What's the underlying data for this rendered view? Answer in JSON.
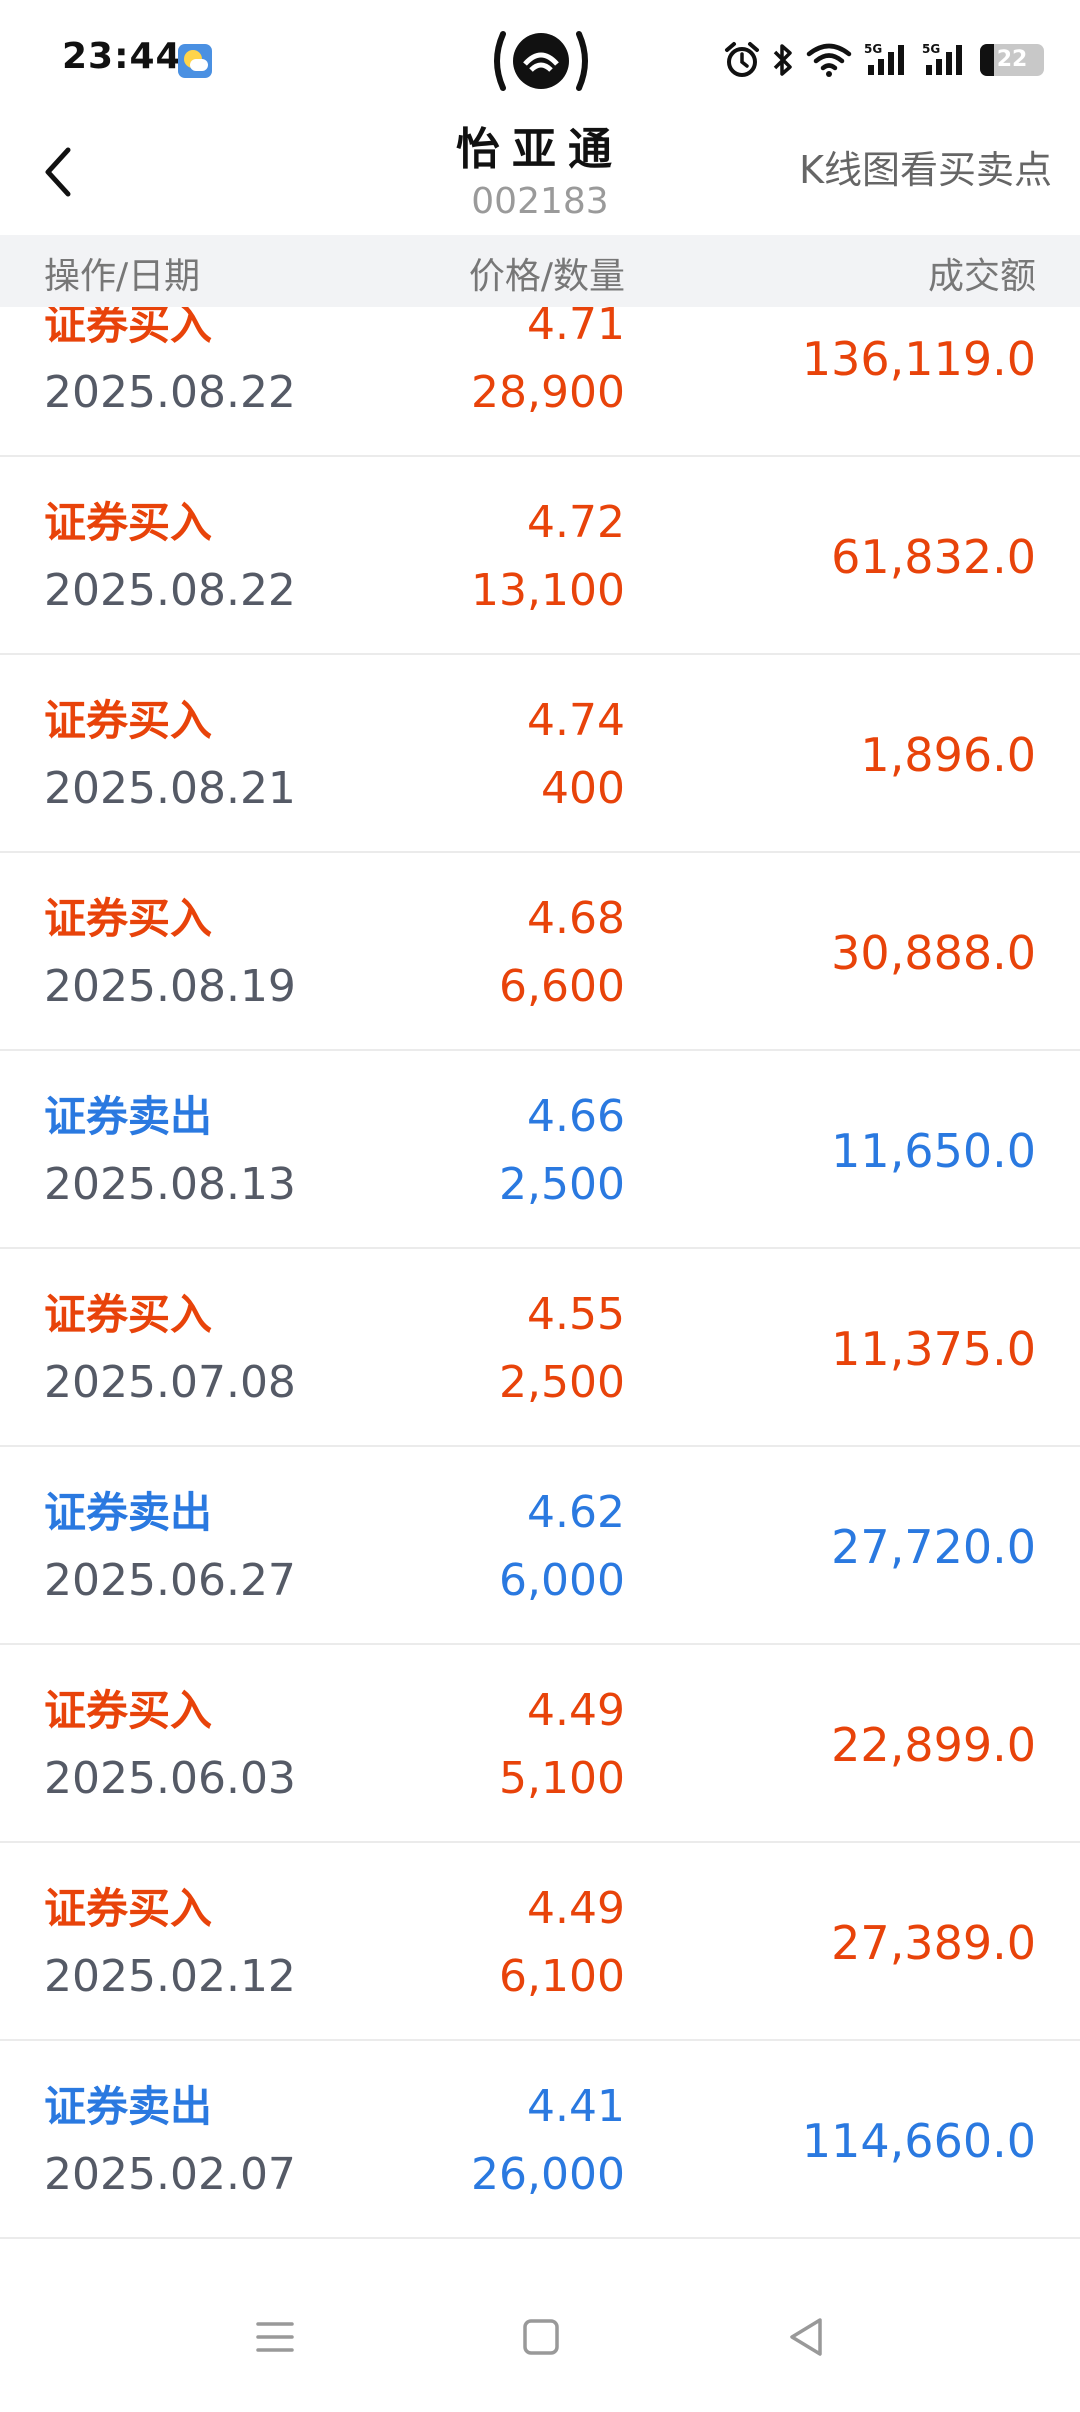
{
  "status_bar": {
    "time": "23:44",
    "battery": "22",
    "weather_icon": "weather-icon",
    "hotspot_icon": "hotspot-icon",
    "right_icons": [
      "alarm-icon",
      "bluetooth-icon",
      "wifi-icon",
      "signal-5g-icon",
      "signal-5g-icon",
      "battery-icon"
    ]
  },
  "header": {
    "title": "怡亚通",
    "code": "002183",
    "kline_link": "K线图看买卖点"
  },
  "columns": {
    "col1": "操作/日期",
    "col2": "价格/数量",
    "col3": "成交额"
  },
  "colors": {
    "buy": "#e8430a",
    "sell": "#2a79e0"
  },
  "rows": [
    {
      "op": "证券买入",
      "date": "2025.08.22",
      "price": "4.71",
      "qty": "28,900",
      "amount": "136,119.0",
      "type": "buy"
    },
    {
      "op": "证券买入",
      "date": "2025.08.22",
      "price": "4.72",
      "qty": "13,100",
      "amount": "61,832.0",
      "type": "buy"
    },
    {
      "op": "证券买入",
      "date": "2025.08.21",
      "price": "4.74",
      "qty": "400",
      "amount": "1,896.0",
      "type": "buy"
    },
    {
      "op": "证券买入",
      "date": "2025.08.19",
      "price": "4.68",
      "qty": "6,600",
      "amount": "30,888.0",
      "type": "buy"
    },
    {
      "op": "证券卖出",
      "date": "2025.08.13",
      "price": "4.66",
      "qty": "2,500",
      "amount": "11,650.0",
      "type": "sell"
    },
    {
      "op": "证券买入",
      "date": "2025.07.08",
      "price": "4.55",
      "qty": "2,500",
      "amount": "11,375.0",
      "type": "buy"
    },
    {
      "op": "证券卖出",
      "date": "2025.06.27",
      "price": "4.62",
      "qty": "6,000",
      "amount": "27,720.0",
      "type": "sell"
    },
    {
      "op": "证券买入",
      "date": "2025.06.03",
      "price": "4.49",
      "qty": "5,100",
      "amount": "22,899.0",
      "type": "buy"
    },
    {
      "op": "证券买入",
      "date": "2025.02.12",
      "price": "4.49",
      "qty": "6,100",
      "amount": "27,389.0",
      "type": "buy"
    },
    {
      "op": "证券卖出",
      "date": "2025.02.07",
      "price": "4.41",
      "qty": "26,000",
      "amount": "114,660.0",
      "type": "sell"
    }
  ],
  "nav_bar": {
    "icons": [
      "menu-icon",
      "home-icon",
      "back-triangle-icon"
    ]
  }
}
